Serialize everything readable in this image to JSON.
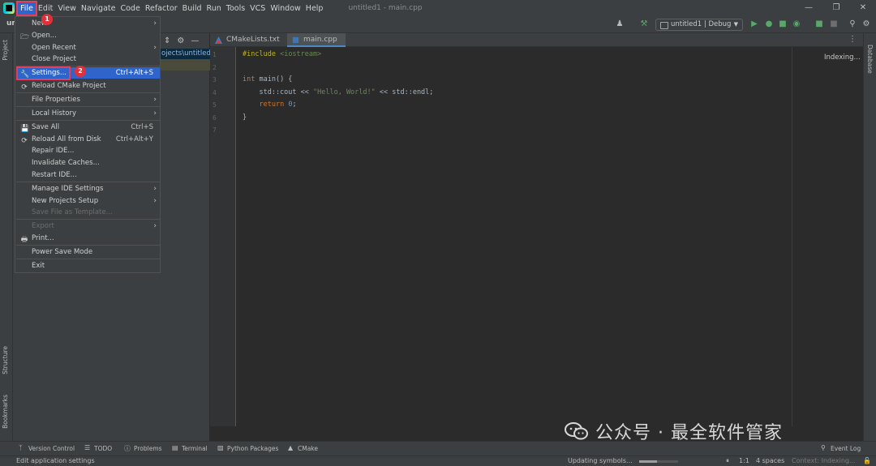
{
  "menubar": {
    "items": [
      "File",
      "Edit",
      "View",
      "Navigate",
      "Code",
      "Refactor",
      "Build",
      "Run",
      "Tools",
      "VCS",
      "Window",
      "Help"
    ],
    "window_title": "untitled1 - main.cpp"
  },
  "window_controls": {
    "minimize": "—",
    "restore": "❐",
    "close": "✕"
  },
  "navbar": {
    "project": "un",
    "run_config": "untitled1 | Debug"
  },
  "project_panel": {
    "path": "ojects\\untitled1"
  },
  "editor": {
    "tabs": [
      {
        "label": "CMakeLists.txt",
        "active": false
      },
      {
        "label": "main.cpp",
        "active": true
      }
    ],
    "line_numbers": [
      "1",
      "2",
      "3",
      "4",
      "5",
      "6",
      "7"
    ],
    "status": "Indexing..."
  },
  "file_menu": {
    "items": [
      {
        "label": "New",
        "shortcut": "",
        "submenu": true
      },
      {
        "label": "Open...",
        "shortcut": "",
        "submenu": false,
        "icon": "folder-icon"
      },
      {
        "label": "Open Recent",
        "shortcut": "",
        "submenu": true
      },
      {
        "label": "Close Project",
        "shortcut": "",
        "submenu": false
      },
      {
        "label": "Settings...",
        "shortcut": "Ctrl+Alt+S",
        "submenu": false,
        "icon": "wrench-icon",
        "selected": true
      },
      {
        "label": "Reload CMake Project",
        "shortcut": "",
        "submenu": false,
        "icon": "reload-icon"
      },
      {
        "label": "File Properties",
        "shortcut": "",
        "submenu": true
      },
      {
        "label": "Local History",
        "shortcut": "",
        "submenu": true
      },
      {
        "label": "Save All",
        "shortcut": "Ctrl+S",
        "submenu": false,
        "icon": "save-icon"
      },
      {
        "label": "Reload All from Disk",
        "shortcut": "Ctrl+Alt+Y",
        "submenu": false,
        "icon": "reload-icon"
      },
      {
        "label": "Repair IDE...",
        "shortcut": "",
        "submenu": false
      },
      {
        "label": "Invalidate Caches...",
        "shortcut": "",
        "submenu": false
      },
      {
        "label": "Restart IDE...",
        "shortcut": "",
        "submenu": false
      },
      {
        "label": "Manage IDE Settings",
        "shortcut": "",
        "submenu": true
      },
      {
        "label": "New Projects Setup",
        "shortcut": "",
        "submenu": true
      },
      {
        "label": "Save File as Template...",
        "shortcut": "",
        "submenu": false,
        "disabled": true
      },
      {
        "label": "Export",
        "shortcut": "",
        "submenu": true,
        "disabled": true
      },
      {
        "label": "Print...",
        "shortcut": "",
        "submenu": false,
        "icon": "print-icon"
      },
      {
        "label": "Power Save Mode",
        "shortcut": "",
        "submenu": false
      },
      {
        "label": "Exit",
        "shortcut": "",
        "submenu": false
      }
    ]
  },
  "badges": {
    "one": "1",
    "two": "2"
  },
  "side_tabs": {
    "project": "Project",
    "structure": "Structure",
    "bookmarks": "Bookmarks",
    "database": "Database"
  },
  "tool_windows": [
    "Version Control",
    "TODO",
    "Problems",
    "Terminal",
    "Python Packages",
    "CMake",
    "Event Log"
  ],
  "status_bar": {
    "hint": "Edit application settings",
    "task": "Updating symbols...",
    "task_progress": 0.45,
    "position": "1:1",
    "indent": "4 spaces",
    "context": "Context: Indexing..."
  },
  "watermark": "公众号 · 最全软件管家",
  "colors": {
    "accent": "#2f65ca",
    "badge": "#e0303a",
    "highlight_border": "#e0405a"
  }
}
